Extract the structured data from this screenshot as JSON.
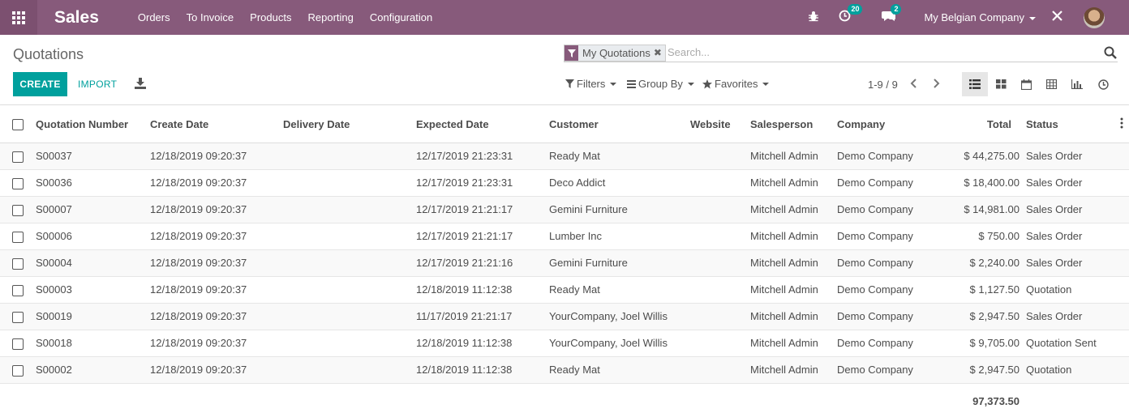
{
  "navbar": {
    "brand": "Sales",
    "menu": [
      "Orders",
      "To Invoice",
      "Products",
      "Reporting",
      "Configuration"
    ],
    "activity_count": "20",
    "messages_count": "2",
    "company": "My Belgian Company",
    "color": "#875a7b"
  },
  "control_panel": {
    "breadcrumb": "Quotations",
    "facet_label": "My Quotations",
    "search_placeholder": "Search...",
    "create_label": "CREATE",
    "import_label": "IMPORT",
    "filters_label": "Filters",
    "groupby_label": "Group By",
    "favorites_label": "Favorites",
    "pager": "1-9 / 9"
  },
  "table": {
    "headers": {
      "number": "Quotation Number",
      "create_date": "Create Date",
      "delivery_date": "Delivery Date",
      "expected_date": "Expected Date",
      "customer": "Customer",
      "website": "Website",
      "salesperson": "Salesperson",
      "company": "Company",
      "total": "Total",
      "status": "Status"
    },
    "rows": [
      {
        "number": "S00037",
        "create_date": "12/18/2019 09:20:37",
        "expected_date": "12/17/2019 21:23:31",
        "customer": "Ready Mat",
        "salesperson": "Mitchell Admin",
        "company": "Demo Company",
        "total": "$ 44,275.00",
        "status": "Sales Order"
      },
      {
        "number": "S00036",
        "create_date": "12/18/2019 09:20:37",
        "expected_date": "12/17/2019 21:23:31",
        "customer": "Deco Addict",
        "salesperson": "Mitchell Admin",
        "company": "Demo Company",
        "total": "$ 18,400.00",
        "status": "Sales Order"
      },
      {
        "number": "S00007",
        "create_date": "12/18/2019 09:20:37",
        "expected_date": "12/17/2019 21:21:17",
        "customer": "Gemini Furniture",
        "salesperson": "Mitchell Admin",
        "company": "Demo Company",
        "total": "$ 14,981.00",
        "status": "Sales Order"
      },
      {
        "number": "S00006",
        "create_date": "12/18/2019 09:20:37",
        "expected_date": "12/17/2019 21:21:17",
        "customer": "Lumber Inc",
        "salesperson": "Mitchell Admin",
        "company": "Demo Company",
        "total": "$ 750.00",
        "status": "Sales Order"
      },
      {
        "number": "S00004",
        "create_date": "12/18/2019 09:20:37",
        "expected_date": "12/17/2019 21:21:16",
        "customer": "Gemini Furniture",
        "salesperson": "Mitchell Admin",
        "company": "Demo Company",
        "total": "$ 2,240.00",
        "status": "Sales Order"
      },
      {
        "number": "S00003",
        "create_date": "12/18/2019 09:20:37",
        "expected_date": "12/18/2019 11:12:38",
        "customer": "Ready Mat",
        "salesperson": "Mitchell Admin",
        "company": "Demo Company",
        "total": "$ 1,127.50",
        "status": "Quotation"
      },
      {
        "number": "S00019",
        "create_date": "12/18/2019 09:20:37",
        "expected_date": "11/17/2019 21:21:17",
        "customer": "YourCompany, Joel Willis",
        "salesperson": "Mitchell Admin",
        "company": "Demo Company",
        "total": "$ 2,947.50",
        "status": "Sales Order"
      },
      {
        "number": "S00018",
        "create_date": "12/18/2019 09:20:37",
        "expected_date": "12/18/2019 11:12:38",
        "customer": "YourCompany, Joel Willis",
        "salesperson": "Mitchell Admin",
        "company": "Demo Company",
        "total": "$ 9,705.00",
        "status": "Quotation Sent"
      },
      {
        "number": "S00002",
        "create_date": "12/18/2019 09:20:37",
        "expected_date": "12/18/2019 11:12:38",
        "customer": "Ready Mat",
        "salesperson": "Mitchell Admin",
        "company": "Demo Company",
        "total": "$ 2,947.50",
        "status": "Quotation"
      }
    ],
    "sum_total": "97,373.50"
  }
}
